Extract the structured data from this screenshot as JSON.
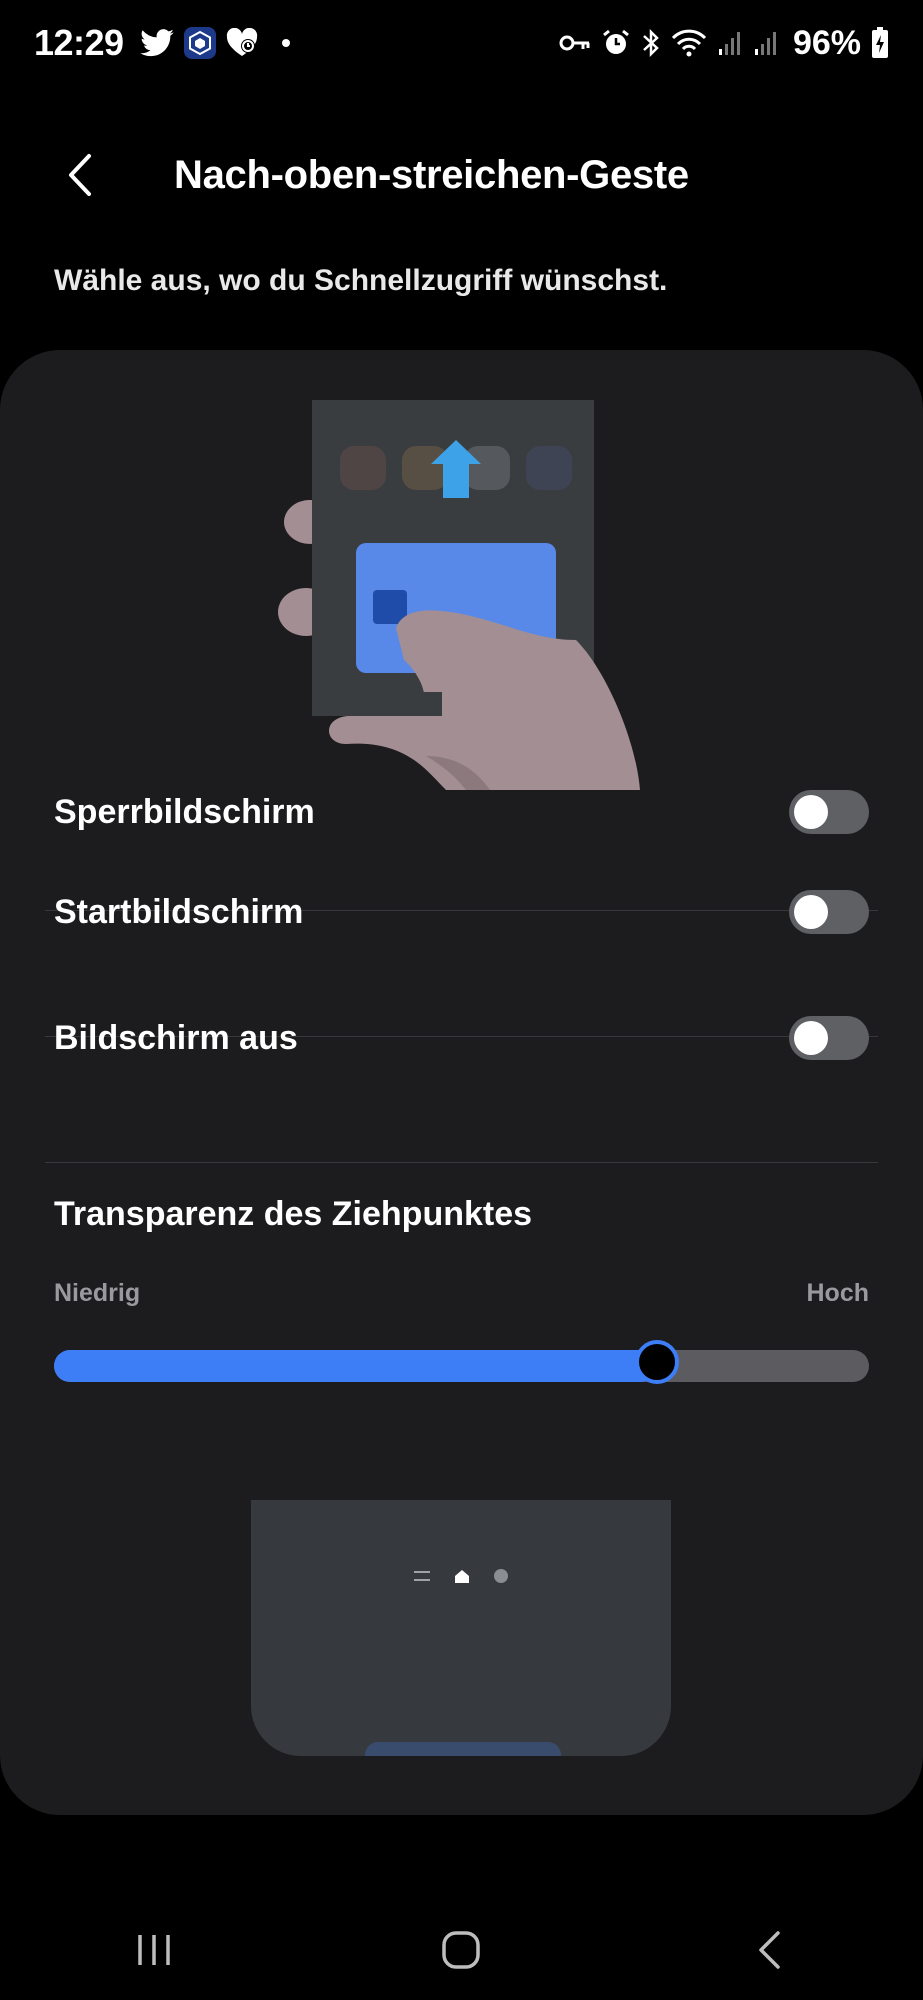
{
  "status_bar": {
    "time": "12:29",
    "battery": "96%",
    "left_icons": [
      "twitter-icon",
      "crypto-app-icon",
      "health-app-icon"
    ],
    "right_icons": [
      "vpn-key-icon",
      "alarm-icon",
      "bluetooth-icon",
      "wifi-icon",
      "signal-icon",
      "signal-icon",
      "battery-charging-icon"
    ]
  },
  "header": {
    "title": "Nach-oben-streichen-Geste"
  },
  "subtitle": "Wähle aus, wo du Schnellzugriff wünschst.",
  "settings": [
    {
      "label": "Sperrbildschirm",
      "enabled": false
    },
    {
      "label": "Startbildschirm",
      "enabled": false
    },
    {
      "label": "Bildschirm aus",
      "enabled": false
    }
  ],
  "transparency": {
    "title": "Transparenz des Ziehpunktes",
    "min_label": "Niedrig",
    "max_label": "Hoch",
    "value_fraction": 0.74
  },
  "colors": {
    "accent": "#3d7ef7",
    "card": "#1c1c1e",
    "background": "#000000"
  },
  "nav_bar": [
    "recents-icon",
    "home-icon",
    "back-icon"
  ]
}
